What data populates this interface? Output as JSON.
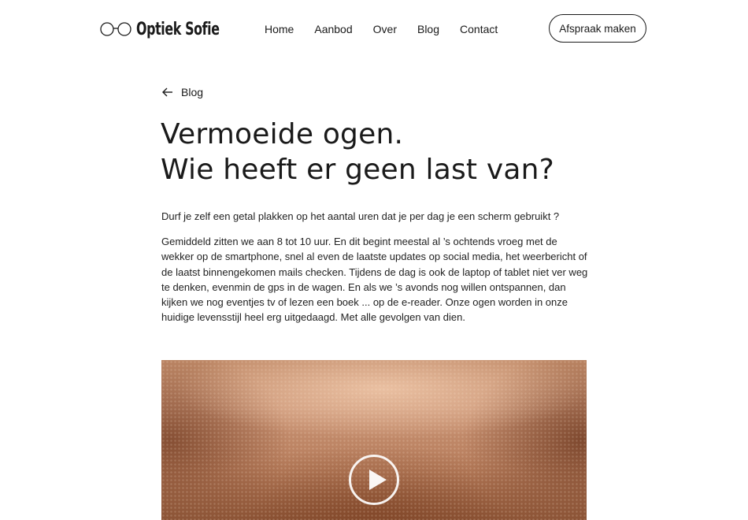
{
  "header": {
    "logo_text": "Optiek Sofie",
    "nav": [
      "Home",
      "Aanbod",
      "Over",
      "Blog",
      "Contact"
    ],
    "cta_label": "Afspraak maken"
  },
  "article": {
    "back_label": "Blog",
    "title_line1": "Vermoeide ogen.",
    "title_line2": "Wie heeft er geen last van?",
    "intro": "Durf je zelf een getal plakken op het aantal uren dat je per dag je een scherm gebruikt ?",
    "body": "Gemiddeld zitten we aan 8 tot 10 uur. En dit begint meestal al ’s ochtends vroeg met de wekker op de smartphone, snel al even de laatste updates op social media, het weerbericht of de laatst binnengekomen mails checken. Tijdens de dag is ook de laptop of tablet niet ver weg te denken, evenmin de gps in de wagen. En als we ’s avonds nog willen ontspannen, dan kijken we nog eventjes tv of lezen een boek ... op de e-reader. Onze ogen worden in onze huidige levensstijl heel erg uitgedaagd. Met alle gevolgen van dien."
  },
  "icons": {
    "logo": "glasses-icon",
    "back": "arrow-left-icon",
    "play": "play-icon"
  },
  "colors": {
    "text": "#1a1a1a",
    "background": "#ffffff"
  }
}
